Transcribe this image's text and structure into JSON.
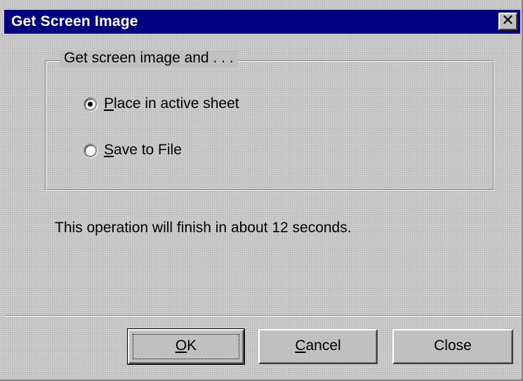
{
  "window": {
    "title": "Get Screen Image",
    "close_glyph": "✕",
    "close_icon": "close-icon"
  },
  "group": {
    "legend": "Get screen image and . . .",
    "options": [
      {
        "mnemonic": "P",
        "rest": "lace in active sheet",
        "selected": true
      },
      {
        "mnemonic": "S",
        "rest": "ave to File",
        "selected": false
      }
    ]
  },
  "info": {
    "text": "This operation will finish in about 12 seconds."
  },
  "buttons": {
    "ok": {
      "mnemonic": "O",
      "rest": "K",
      "default": true
    },
    "cancel": {
      "mnemonic": "C",
      "rest": "ancel"
    },
    "close": {
      "label": "Close"
    }
  },
  "colors": {
    "titlebar": "#000080",
    "face": "#c0c0c0"
  }
}
